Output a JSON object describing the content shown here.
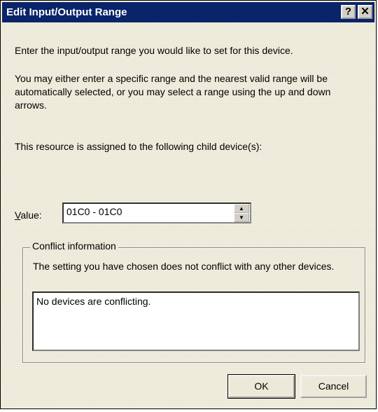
{
  "window": {
    "title": "Edit Input/Output Range",
    "help_glyph": "?",
    "close_glyph": "✕"
  },
  "intro": {
    "line1": "Enter the input/output range you would like to set for this device.",
    "line2": "You may either enter a specific range and the nearest valid range will be automatically selected, or you may select a range using the up and down arrows.",
    "line3": "This resource is assigned to the following child device(s):"
  },
  "value": {
    "label_prefix": "V",
    "label_rest": "alue:",
    "current": "01C0 - 01C0"
  },
  "conflict": {
    "group_label": "Conflict information",
    "description": "The setting you have chosen does not conflict with any other devices.",
    "list_text": "No devices are conflicting."
  },
  "buttons": {
    "ok": "OK",
    "cancel": "Cancel"
  },
  "colors": {
    "titlebar": "#0a246a",
    "face": "#ece9d8"
  }
}
